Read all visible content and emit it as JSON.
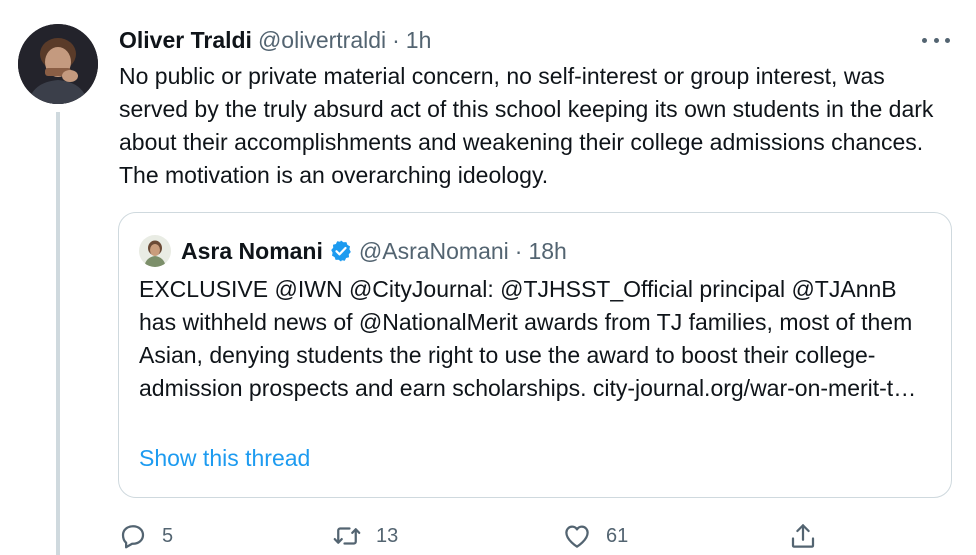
{
  "tweet": {
    "author": {
      "display_name": "Oliver Traldi",
      "handle": "@olivertraldi",
      "separator": "·",
      "time": "1h",
      "avatar_icon": "user-avatar-photo"
    },
    "text": "No public or private material concern, no self-interest or group interest, was served by the truly absurd act of this school keeping its own students in the dark about their accomplishments and weakening their college admissions chances. The motivation is an overarching ideology.",
    "more_icon": "more-horizontal-icon",
    "quote": {
      "author": {
        "display_name": "Asra Nomani",
        "handle": "@AsraNomani",
        "separator": "·",
        "time": "18h",
        "verified": true,
        "avatar_icon": "user-avatar-photo"
      },
      "text": "EXCLUSIVE @IWN @CityJournal: @TJHSST_Official principal @TJAnnB has withheld news of @NationalMerit awards from TJ families, most of them Asian, denying students the right to use the award to boost their college-admission prospects and earn scholarships. city-journal.org/war-on-merit-t…",
      "show_thread": "Show this thread"
    },
    "actions": {
      "reply": {
        "icon": "reply-icon",
        "count": "5"
      },
      "retweet": {
        "icon": "retweet-icon",
        "count": "13"
      },
      "like": {
        "icon": "heart-icon",
        "count": "61"
      },
      "share": {
        "icon": "share-icon"
      }
    }
  },
  "colors": {
    "text_primary": "#0f1419",
    "text_secondary": "#536471",
    "link": "#1d9bf0",
    "verified": "#1d9bf0",
    "border": "#cfd9de"
  }
}
